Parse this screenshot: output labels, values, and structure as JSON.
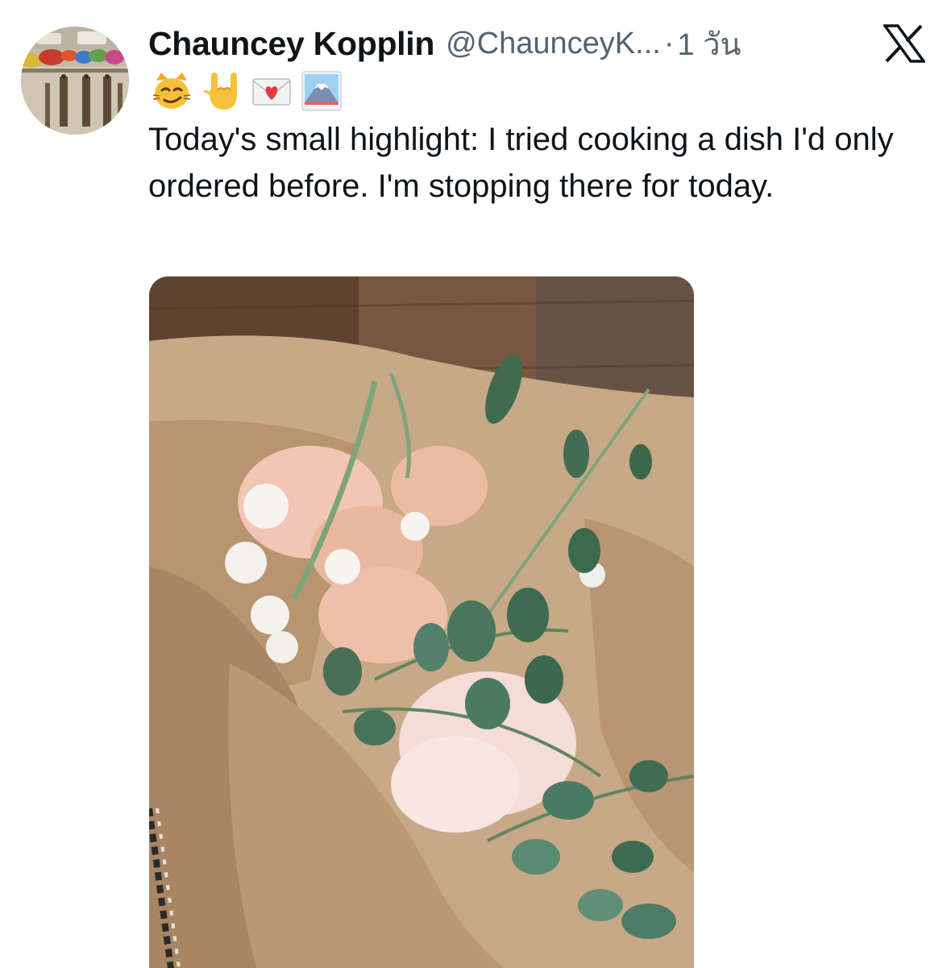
{
  "tweet": {
    "author": {
      "display_name": "Chauncey Kopplin",
      "handle": "@ChaunceyK...",
      "separator": "·",
      "time": "1 วัน",
      "avatar_icon": "avatar-photo"
    },
    "emojis": [
      "smirking-cat-icon",
      "love-you-gesture-icon",
      "love-letter-icon",
      "mount-fuji-icon"
    ],
    "platform_icon": "x-logo-icon",
    "text": "Today's small highlight: I tried cooking a dish I'd only ordered before. I'm stopping there for today.",
    "media": {
      "type": "photo",
      "description_icon": "flower-bouquet-photo"
    }
  },
  "colors": {
    "text_primary": "#0f1419",
    "text_secondary": "#536471",
    "background": "#ffffff"
  }
}
